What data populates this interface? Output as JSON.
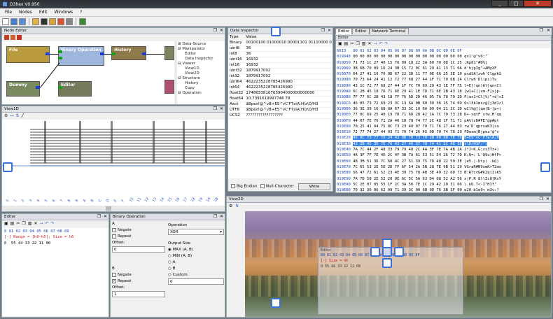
{
  "app": {
    "title": "D3hex V0.950"
  },
  "menu": [
    "File",
    "Nodes",
    "Edit",
    "Windows",
    "?"
  ],
  "node_editor": {
    "title": "Node Editor",
    "nodes": [
      {
        "label": "File",
        "color": "#b99b3e"
      },
      {
        "label": "Binary Operation",
        "color": "#9fb6dc"
      },
      {
        "label": "History",
        "color": "#8e7a4a"
      },
      {
        "label": "Editor",
        "color": "#7c8560"
      },
      {
        "label": "Dummy",
        "color": "#7b8a5e"
      },
      {
        "label": "Editor",
        "color": "#737a5a"
      },
      {
        "label": "Selection",
        "color": "#737a5a"
      }
    ],
    "tree": [
      "Data-Source",
      "Manipulator",
      "Editor",
      "Data Inspector",
      "Viewer",
      "View1D",
      "View2D",
      "Structure",
      "History",
      "Copy",
      "Operation"
    ]
  },
  "view1d": {
    "title": "View1D",
    "axis_labels": [
      "0",
      "1",
      "2",
      "3",
      "4",
      "5",
      "6",
      "7",
      "8",
      "9",
      "A",
      "B",
      "C",
      "D",
      "E",
      "F",
      "10",
      "11",
      "12",
      "13",
      "14",
      "15",
      "16",
      "17",
      "18",
      "19",
      "1A",
      "1B"
    ]
  },
  "inspector": {
    "title": "Data Inspector",
    "headers": [
      "Type",
      "Value"
    ],
    "rows": [
      [
        "Binary",
        "00100100 01000010 00001101 01110000 01110"
      ],
      [
        "uint8",
        "36"
      ],
      [
        "int8",
        "36"
      ],
      [
        "uint16",
        "16932"
      ],
      [
        "int16",
        "16932"
      ],
      [
        "uint32",
        "1879917092"
      ],
      [
        "int32",
        "1879917092"
      ],
      [
        "uint64",
        "4622235228785426980"
      ],
      [
        "int64",
        "4622235228785426980"
      ],
      [
        "float32",
        "1748653816763904000000000000"
      ],
      [
        "float64",
        "10.7391619997746 78"
      ],
      [
        "Ascii",
        "$Bpez!@^vB+E5^vC'F7a\\A;H\\z\\D/H3"
      ],
      [
        "UTF8",
        "$Bpez!@^vB+E5^vC'F7a\\A;H\\z\\D/H3"
      ],
      [
        "UCS2",
        "??????????????????"
      ]
    ],
    "big_endian": "Big Endian",
    "null_char": "Null-Character",
    "write": "Write"
  },
  "editor_tabs": [
    "Editor",
    "Editor",
    "Network Terminal"
  ],
  "hex_editor": {
    "title": "Editor",
    "header_addr": "6613",
    "header_cols": "00 01 02 03 04 05 06 07 08 09 0A 0B 0C 0D 0E 0F",
    "rows": [
      {
        "addr": "019D40",
        "hex": "00 00 00 00 00 00 00 00 00 00 00 00 00 00 00 00",
        "ascii": "qx1'@\"v0;\"`"
      },
      {
        "addr": "019D50",
        "hex": "71 73 1C 27 40 15 76 09 18 22 3A 60 70 08 1C 25",
        "ascii": ";Kp01\"#D%j"
      },
      {
        "addr": "019D60",
        "hex": "3B 6B 70 09 1D 24 3B 15 72 0C 61 29 41 13 71 0A",
        "ascii": "d'hjpIg\"+AMyXF"
      },
      {
        "addr": "019D70",
        "hex": "64 27 41 10 70 0D 67 22 3D 11 77 0E 66 25 3E 10",
        "ascii": "pxdSA]zwh'ClgpkS"
      },
      {
        "addr": "019D80",
        "addr2": "",
        "hex": "70 73 64 24 41 12 72 77 68 27 44 1F 71 70 6B 24",
        "ascii": "Clrwh'Dl(pi)Tu"
      },
      {
        "addr": "019D90",
        "hex": "43 1C 72 77 68 27 44 1F 7C 70 69 29 43 1E 7F 75",
        "ascii": "l+E]!qn)Al}qn<Cl"
      },
      {
        "addr": "019DA0",
        "hex": "6C 2B 45 18 7D 71 6E 29 41 1E 7D 71 6E 2B 43 18",
        "ascii": "[w1+C[|vm-F[x|p-"
      },
      {
        "addr": "019DB0",
        "hex": "7F 77 6C 2B 43 18 7F 76 6D 2D 46 05 7A 78 70 2D",
        "ascii": "F|ax1+Cl[%/\"+d!sI"
      },
      {
        "addr": "019DC0",
        "hex": "46 05 73 72 69 23 3C 13 6A 0B 60 30 36 15 74 09",
        "ascii": "6>l3k1ms<@]j3d1<l"
      },
      {
        "addr": "019DD0",
        "hex": "36 3E 39 16 6B 0A 67 33 3C 10 6A 09 64 21 3C 1D",
        "ascii": "wCl%@]|qm(B-|p+("
      },
      {
        "addr": "019DE0",
        "hex": "77 0C 69 25 40 19 7D 71 6D 28 42 1A 7C 70 73 28",
        "ascii": "D+-vqtF xtw,H'qq"
      },
      {
        "addr": "019DF0",
        "hex": "44 07 7E 76 71 2A 46 1D 78 74 77 2C 48 1F 71 71",
        "ascii": "pA%lsD#FE\"@p#pt"
      },
      {
        "addr": "019E00",
        "hex": "70 25 41 04 75 0C 73 23 40 07 70 71 76 27 44 03",
        "ascii": "rw'D'qprsaK3|xu"
      },
      {
        "addr": "019E10",
        "hex": "72 77 74 27 44 03 71 70 74 26 45 0D 70 74 78 29",
        "ascii": "FDwxm[Bjpez!@^v"
      },
      {
        "addr": "019E20",
        "hex": "46 0C 73 77 70 24 42 0D 70 73 70 28 40 0D 7E 76",
        "ascii": "B+E5^vC'F7a\\A;H",
        "sel": true
      },
      {
        "addr": "019E30",
        "hex": "42 2B 45 35 7E 76 43 27 46 37 78 74 41 2C 48 3E",
        "ascii": "z\\D/H3F;^}",
        "sel": true
      },
      {
        "addr": "019E40",
        "hex": "7A 7C 44 2F 48 33 79 79 48 2C 4A 3F 7E 7A 4B 2A",
        "ascii": "J*J~K,G;zs3Tz+)"
      },
      {
        "addr": "019E50",
        "hex": "4A 3F 7F 7E 4E 2C 4F 3B 7A 61 53 51 54 26 72 7D",
        "ascii": "K;Q=;'L'Q9u)HfP>"
      },
      {
        "addr": "019E60",
        "hex": "4B 3B 51 3D 7C 60 4C 27 51 39 75 7D 48 22 50 3E",
        "ascii": "|e5.|-Uty( -kQ)"
      },
      {
        "addr": "019E70",
        "hex": "7C 65 53 2E 5D 2D 7F 6F 54 2A 5B 28 7E 6B 51 29",
        "ascii": "VGraR#N9xmK>T2ms"
      },
      {
        "addr": "019E80",
        "hex": "56 47 72 61 52 23 4E 39 75 78 4B 3E 49 32 6D 73",
        "ascii": "B:R7cvG#k2q(I)K5"
      },
      {
        "addr": "019E90",
        "hex": "7A 7D 50 2E 52 20 0E 6C 5C 5A 63 D4 08 52 A2 56",
        "ascii": "x|P.R 8l\\ZcO]RsY"
      },
      {
        "addr": "019EA0",
        "hex": "5C 2E 07 05 55 1F 2C 3A 56 7E 1C 29 42 10 31 66",
        "ascii": "\\.kU.T<-I\"H1f\""
      },
      {
        "addr": "019EB0",
        "hex": "70 32 30 06 62 09 71 39 3C 00 6B 0D 76 3B 3F 00",
        "ascii": "p20-b1q9< m3v;?"
      }
    ]
  },
  "small_editor": {
    "title": "Editor",
    "header": "0 01 02 03 04 05 06 07 08 09",
    "range": "[-] Range = [h0-h5]; Size = h6",
    "row": "0  55 44 33 22 11 00"
  },
  "binop": {
    "title": "Binary Operation",
    "a": "A",
    "negate": "Negate",
    "repeat": "Repeat",
    "offset": "Offset:",
    "offset_a": "0",
    "b": "B",
    "offset_b": "1",
    "operation_label": "Operation",
    "operation": "XOR",
    "output_size": "Output Size",
    "opts": [
      "MAX (A, B)",
      "MIN (A, B)",
      "A",
      "B",
      "Custom:"
    ],
    "custom": "0"
  },
  "view2d": {
    "title": "View2D",
    "float_editor": {
      "title": "Editor",
      "cols": "00 01 02 03 04 05 06 07 08 09 0A 0B 0C 0D 0E 0F",
      "range": "[-] Size = h6",
      "row": "0  55 44 33 22 11 00"
    }
  }
}
